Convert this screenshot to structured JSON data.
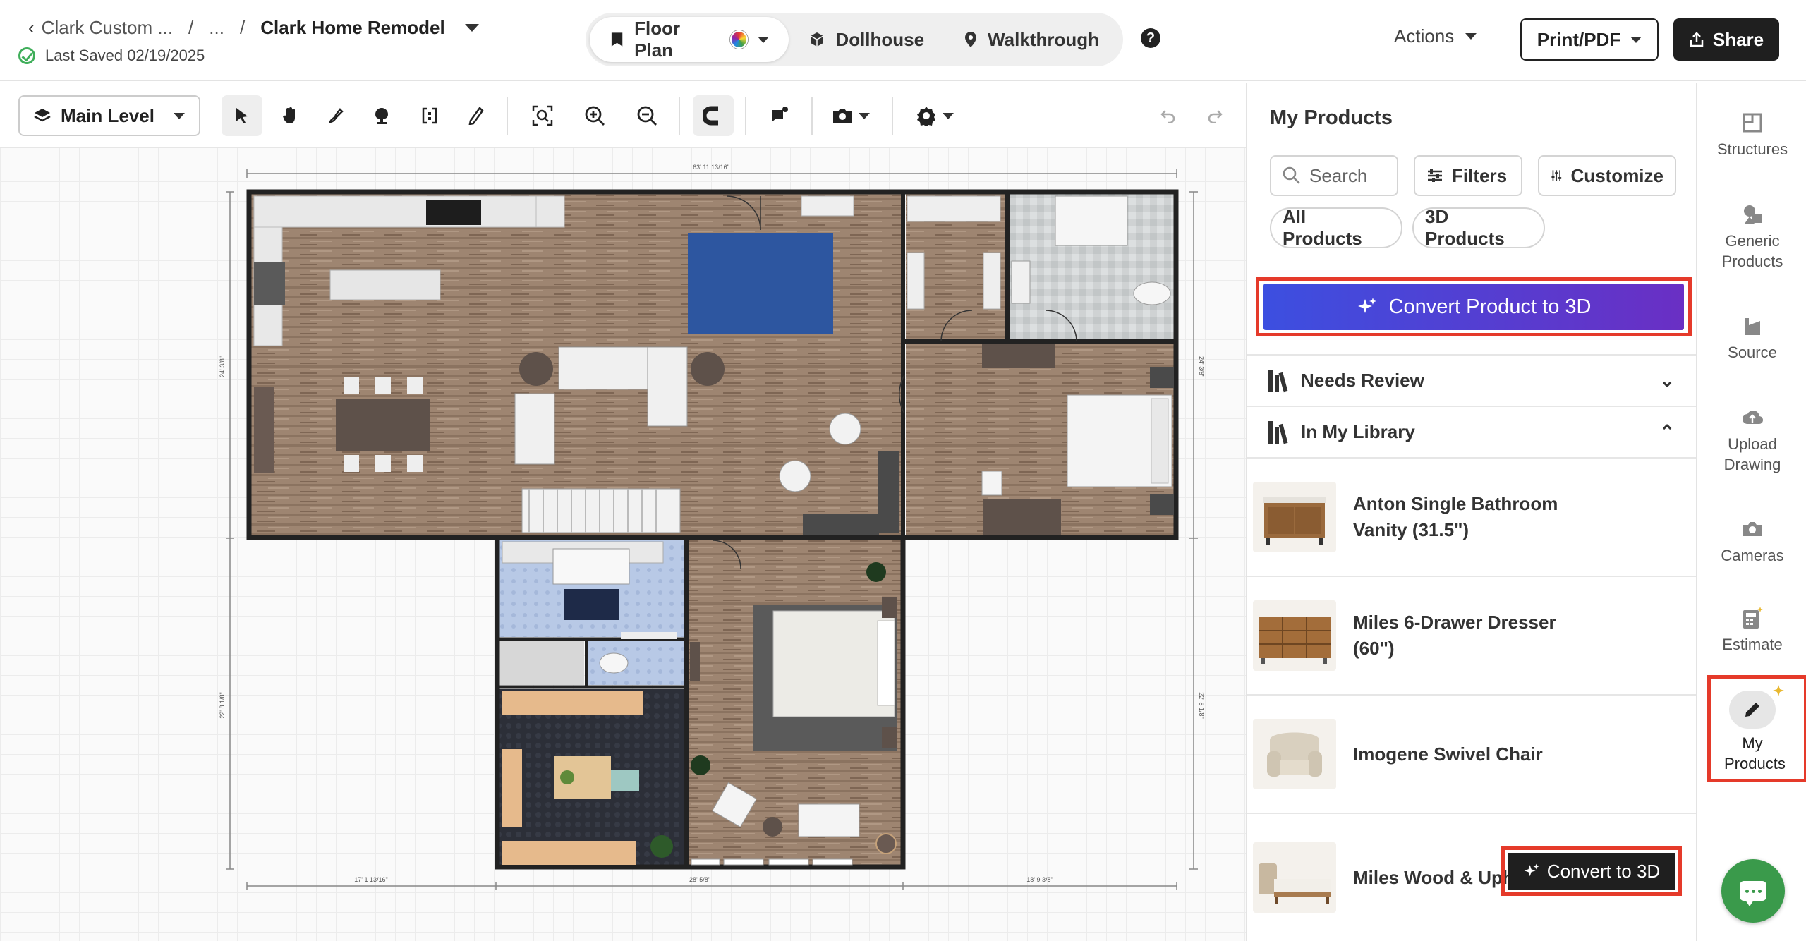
{
  "breadcrumb": {
    "back_label": "Clark Custom ...",
    "sep1": "/",
    "ellipsis": "...",
    "sep2": "/",
    "project": "Clark Home Remodel"
  },
  "save_status": "Last Saved 02/19/2025",
  "view_switcher": {
    "floor_plan": "Floor Plan",
    "dollhouse": "Dollhouse",
    "walkthrough": "Walkthrough",
    "active": "Floor Plan"
  },
  "help_label": "?",
  "header_actions": {
    "actions": "Actions",
    "print": "Print/PDF",
    "share": "Share"
  },
  "toolbar": {
    "level": "Main Level",
    "tools": [
      "select-icon",
      "pan-icon",
      "draw-wall-icon",
      "place-object-icon",
      "room-icon",
      "measure-icon",
      "fit-screen-icon",
      "zoom-in-icon",
      "zoom-out-icon",
      "snap-icon",
      "annotation-icon",
      "camera-icon",
      "settings-icon",
      "undo-icon",
      "redo-icon"
    ]
  },
  "floor_plan": {
    "dim_top": "63' 11 13/16\"",
    "dim_left_upper": "24' 3/8\"",
    "dim_right_upper": "24' 3/8\"",
    "dim_left_lower": "22' 8 1/8\"",
    "dim_right_lower": "22' 8 1/8\"",
    "dim_bottom_left": "17' 1 13/16\"",
    "dim_bottom_mid": "28' 5/8\"",
    "dim_bottom_right": "18' 9 3/8\""
  },
  "panel": {
    "title": "My Products",
    "search_placeholder": "Search",
    "filters": "Filters",
    "customize": "Customize",
    "all_products": "All Products",
    "three_d_products": "3D Products",
    "convert_button": "Convert Product to 3D",
    "needs_review": "Needs Review",
    "in_my_library": "In My Library",
    "products": [
      {
        "name": "Anton Single Bathroom Vanity (31.5\")",
        "thumb": "vanity"
      },
      {
        "name": "Miles 6-Drawer Dresser (60\")",
        "thumb": "dresser"
      },
      {
        "name": "Imogene Swivel Chair",
        "thumb": "chair"
      },
      {
        "name": "Miles Wood & Uph Bed",
        "thumb": "bed"
      }
    ],
    "convert_to_3d": "Convert to 3D"
  },
  "sidebar": {
    "items": [
      {
        "label": "Structures",
        "icon": "structures-icon"
      },
      {
        "label": "Generic Products",
        "icon": "generic-products-icon"
      },
      {
        "label": "Source",
        "icon": "source-icon"
      },
      {
        "label": "Upload Drawing",
        "icon": "upload-drawing-icon"
      },
      {
        "label": "Cameras",
        "icon": "camera-icon"
      },
      {
        "label": "Estimate",
        "icon": "estimate-icon"
      },
      {
        "label": "My Products",
        "icon": "my-products-icon"
      }
    ]
  },
  "colors": {
    "accent_gradient_start": "#3c4fe0",
    "accent_gradient_end": "#6a2fc4",
    "highlight_red": "#e53a2a",
    "chat_green": "#3a9a4b",
    "wood_floor": "#9e8571"
  }
}
